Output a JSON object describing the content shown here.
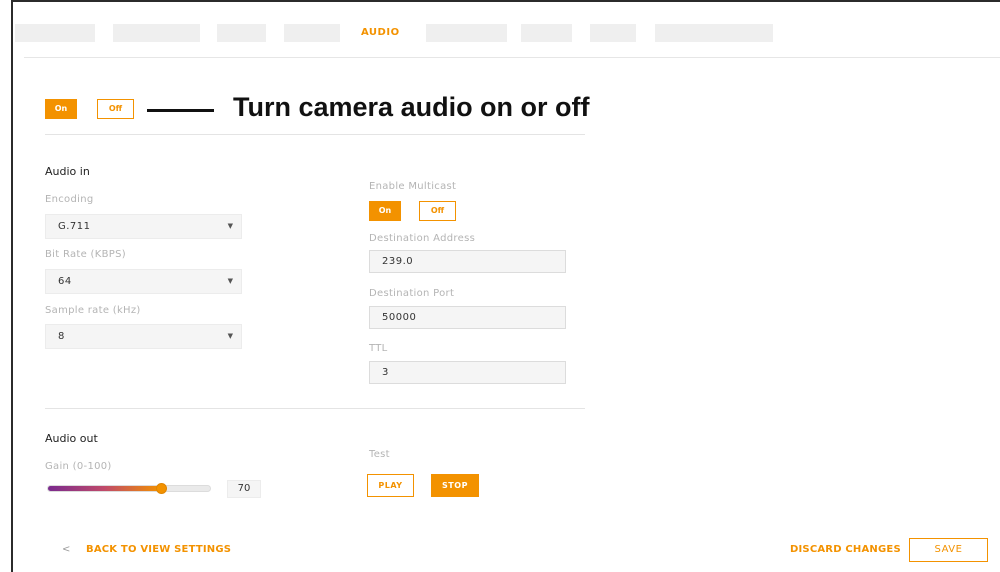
{
  "nav": {
    "tabs": [
      {
        "label": "",
        "active": false
      },
      {
        "label": "",
        "active": false
      },
      {
        "label": "",
        "active": false
      },
      {
        "label": "",
        "active": false
      },
      {
        "label": "AUDIO",
        "active": true
      },
      {
        "label": "",
        "active": false
      },
      {
        "label": "",
        "active": false
      },
      {
        "label": "",
        "active": false
      },
      {
        "label": "",
        "active": false
      }
    ]
  },
  "audio_toggle": {
    "on_label": "On",
    "off_label": "Off",
    "state": "on"
  },
  "annotation": "Turn camera audio on or off",
  "audio_in": {
    "heading": "Audio in",
    "encoding": {
      "label": "Encoding",
      "value": "G.711"
    },
    "bit_rate": {
      "label": "Bit Rate (KBPS)",
      "value": "64"
    },
    "sample_rate": {
      "label": "Sample rate (kHz)",
      "value": "8"
    },
    "multicast": {
      "label": "Enable Multicast",
      "on_label": "On",
      "off_label": "Off",
      "state": "on"
    },
    "destination_address": {
      "label": "Destination Address",
      "value": "239.0"
    },
    "destination_port": {
      "label": "Destination Port",
      "value": "50000"
    },
    "ttl": {
      "label": "TTL",
      "value": "3"
    }
  },
  "audio_out": {
    "heading": "Audio out",
    "gain": {
      "label": "Gain (0-100)",
      "value": 70
    },
    "test": {
      "label": "Test",
      "play_label": "PLAY",
      "stop_label": "STOP"
    }
  },
  "footer": {
    "back_arrow": "<",
    "back_label": "BACK TO VIEW SETTINGS",
    "discard_label": "DISCARD CHANGES",
    "save_label": "SAVE"
  },
  "colors": {
    "accent": "#f39200",
    "field_bg": "#f5f5f5"
  },
  "icons": {
    "dropdown_caret": "chevron-down-icon",
    "back": "chevron-left-icon"
  }
}
